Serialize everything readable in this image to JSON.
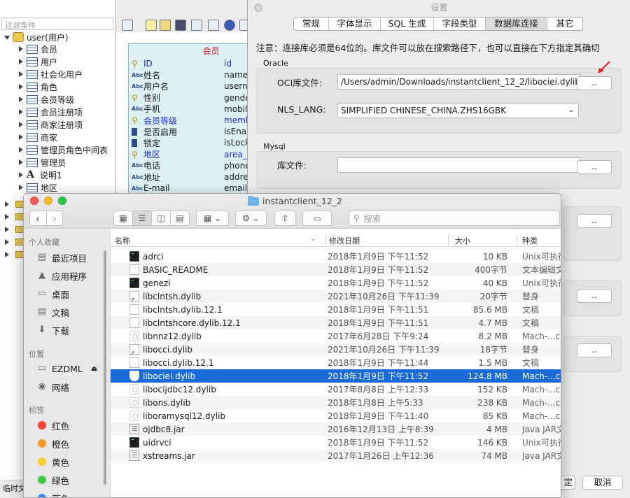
{
  "tree": {
    "filter_placeholder": "过滤条件",
    "root": "user(用户)",
    "items": [
      "会员",
      "用户",
      "社会化用户",
      "角色",
      "会员等级",
      "会员注册项",
      "商家注册项",
      "商家",
      "管理员角色中间表",
      "管理员",
      "说明1",
      "地区"
    ],
    "status": "临时文"
  },
  "entity": {
    "title": "会员",
    "fields": [
      {
        "icon": "key",
        "name": "ID",
        "code": "id",
        "highlight": true
      },
      {
        "icon": "abc",
        "name": "姓名",
        "code": "name",
        "highlight": false
      },
      {
        "icon": "abc",
        "name": "用户名",
        "code": "userna",
        "highlight": false
      },
      {
        "icon": "key",
        "name": "性别",
        "code": "gende",
        "highlight": false
      },
      {
        "icon": "abc",
        "name": "手机",
        "code": "mobile",
        "highlight": false
      },
      {
        "icon": "key",
        "name": "会员等级",
        "code": "memb",
        "highlight": true
      },
      {
        "icon": "bar",
        "name": "是否启用",
        "code": "isEnab",
        "highlight": false
      },
      {
        "icon": "bar",
        "name": "锁定",
        "code": "isLock",
        "highlight": false
      },
      {
        "icon": "key",
        "name": "地区",
        "code": "area_ic",
        "highlight": true
      },
      {
        "icon": "abc",
        "name": "电话",
        "code": "phone",
        "highlight": false
      },
      {
        "icon": "abc",
        "name": "地址",
        "code": "addres",
        "highlight": false
      },
      {
        "icon": "abc",
        "name": "E-mail",
        "code": "email",
        "highlight": false
      }
    ]
  },
  "settings": {
    "title": "设置",
    "tabs": [
      "常规",
      "字体显示",
      "SQL 生成",
      "字段类型",
      "数据库连接",
      "其它"
    ],
    "active_tab": "数据库连接",
    "note": "注意：连接库必须是64位的。库文件可以放在搜索路径下，也可以直接在下方指定其确切",
    "oracle": {
      "group": "Oracle",
      "oci_label": "OCI库文件:",
      "oci_value": "/Users/admin/Downloads/instantclient_12_2/libociei.dylib",
      "browse": "..",
      "nls_label": "NLS_LANG:",
      "nls_value": "SIMPLIFIED CHINESE_CHINA.ZHS16GBK"
    },
    "mysql": {
      "group": "Mysql",
      "lib_label": "库文件:",
      "lib_value": "",
      "browse": ".."
    },
    "extra_browse": "..",
    "ok_partial": "定",
    "cancel": "取消"
  },
  "finder": {
    "title": "instantclient_12_2",
    "search_placeholder": "搜索",
    "sidebar": {
      "personal_head": "个人收藏",
      "personal": [
        {
          "icon": "recent-icon",
          "label": "最近项目"
        },
        {
          "icon": "applications-icon",
          "label": "应用程序"
        },
        {
          "icon": "desktop-icon",
          "label": "桌面"
        },
        {
          "icon": "documents-icon",
          "label": "文稿"
        },
        {
          "icon": "downloads-icon",
          "label": "下载"
        }
      ],
      "location_head": "位置",
      "locations": [
        {
          "icon": "disk-icon",
          "label": "EZDML"
        },
        {
          "icon": "network-icon",
          "label": "网络"
        }
      ],
      "tags_head": "标签",
      "tags": [
        {
          "label": "红色",
          "color": "#f0443c"
        },
        {
          "label": "橙色",
          "color": "#f89a30"
        },
        {
          "label": "黄色",
          "color": "#f8d030"
        },
        {
          "label": "绿色",
          "color": "#48c848"
        },
        {
          "label": "蓝色",
          "color": "#3c88f0"
        }
      ]
    },
    "columns": [
      "名称",
      "修改日期",
      "大小",
      "种类"
    ],
    "files": [
      {
        "icon": "exec",
        "name": "adrci",
        "date": "2018年1月9日 下午11:52",
        "size": "10 KB",
        "kind": "Unix可执行"
      },
      {
        "icon": "doc",
        "name": "BASIC_README",
        "date": "2018年1月9日 下午11:52",
        "size": "400字节",
        "kind": "文本编辑文"
      },
      {
        "icon": "exec",
        "name": "genezi",
        "date": "2018年1月9日 下午11:52",
        "size": "40 KB",
        "kind": "Unix可执行"
      },
      {
        "icon": "alias",
        "name": "libclntsh.dylib",
        "date": "2021年10月26日 下午11:39",
        "size": "20字节",
        "kind": "替身"
      },
      {
        "icon": "doc",
        "name": "libclntsh.dylib.12.1",
        "date": "2018年1月9日 下午11:51",
        "size": "85.6 MB",
        "kind": "文稿"
      },
      {
        "icon": "doc",
        "name": "libclntshcore.dylib.12.1",
        "date": "2018年1月9日 下午11:51",
        "size": "4.7 MB",
        "kind": "文稿"
      },
      {
        "icon": "lib",
        "name": "libnnz12.dylib",
        "date": "2017年6月28日 下午9:24",
        "size": "8.2 MB",
        "kind": "Mach-...c"
      },
      {
        "icon": "alias",
        "name": "libocci.dylib",
        "date": "2021年10月26日 下午11:39",
        "size": "18字节",
        "kind": "替身"
      },
      {
        "icon": "doc",
        "name": "libocci.dylib.12.1",
        "date": "2018年1月9日 下午11:44",
        "size": "1.5 MB",
        "kind": "文稿"
      },
      {
        "icon": "shield",
        "name": "libociei.dylib",
        "date": "2018年1月9日 下午11:52",
        "size": "124.8 MB",
        "kind": "Mach-...c",
        "selected": true
      },
      {
        "icon": "lib",
        "name": "libocijdbc12.dylib",
        "date": "2017年8月8日 上午12:33",
        "size": "152 KB",
        "kind": "Mach-...c"
      },
      {
        "icon": "lib",
        "name": "libons.dylib",
        "date": "2018年1月8日 上午5:33",
        "size": "238 KB",
        "kind": "Mach-...c"
      },
      {
        "icon": "lib",
        "name": "liboramysql12.dylib",
        "date": "2018年1月9日 下午11:40",
        "size": "85 KB",
        "kind": "Mach-...c"
      },
      {
        "icon": "jar",
        "name": "ojdbc8.jar",
        "date": "2016年12月13日 上午8:39",
        "size": "4 MB",
        "kind": "Java JAR文"
      },
      {
        "icon": "exec",
        "name": "uidrvci",
        "date": "2018年1月9日 下午11:52",
        "size": "146 KB",
        "kind": "Unix可执行"
      },
      {
        "icon": "jar",
        "name": "xstreams.jar",
        "date": "2017年1月26日 上午12:36",
        "size": "74 MB",
        "kind": "Java JAR文"
      }
    ]
  },
  "colors": {
    "accent": "#1a6ad8",
    "annotation_arrow": "#e02020",
    "entity_title": "#c82020"
  }
}
